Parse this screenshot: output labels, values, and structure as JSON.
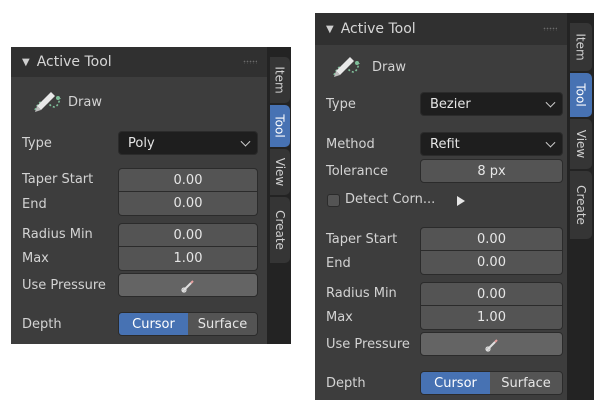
{
  "left": {
    "header": {
      "title": "Active Tool"
    },
    "tool_name": "Draw",
    "type": {
      "label": "Type",
      "value": "Poly"
    },
    "taper_start": {
      "label": "Taper Start",
      "value": "0.00"
    },
    "taper_end": {
      "label": "End",
      "value": "0.00"
    },
    "radius_min": {
      "label": "Radius Min",
      "value": "0.00"
    },
    "radius_max": {
      "label": "Max",
      "value": "1.00"
    },
    "use_pressure": {
      "label": "Use Pressure"
    },
    "depth": {
      "label": "Depth",
      "options": [
        "Cursor",
        "Surface"
      ],
      "selected": "Cursor"
    },
    "tabs": [
      "Item",
      "Tool",
      "View",
      "Create"
    ],
    "active_tab": "Tool"
  },
  "right": {
    "header": {
      "title": "Active Tool"
    },
    "tool_name": "Draw",
    "type": {
      "label": "Type",
      "value": "Bezier"
    },
    "method": {
      "label": "Method",
      "value": "Refit"
    },
    "tolerance": {
      "label": "Tolerance",
      "value": "8 px"
    },
    "detect_corners": {
      "label": "Detect Corn..."
    },
    "taper_start": {
      "label": "Taper Start",
      "value": "0.00"
    },
    "taper_end": {
      "label": "End",
      "value": "0.00"
    },
    "radius_min": {
      "label": "Radius Min",
      "value": "0.00"
    },
    "radius_max": {
      "label": "Max",
      "value": "1.00"
    },
    "use_pressure": {
      "label": "Use Pressure"
    },
    "depth": {
      "label": "Depth",
      "options": [
        "Cursor",
        "Surface"
      ],
      "selected": "Cursor"
    },
    "tabs": [
      "Item",
      "Tool",
      "View",
      "Create"
    ],
    "active_tab": "Tool"
  },
  "colors": {
    "panel_bg": "#3d3d3d",
    "header_bg": "#303030",
    "field_bg": "#545454",
    "dropdown_bg": "#1e1e1e",
    "accent": "#4772b3"
  }
}
